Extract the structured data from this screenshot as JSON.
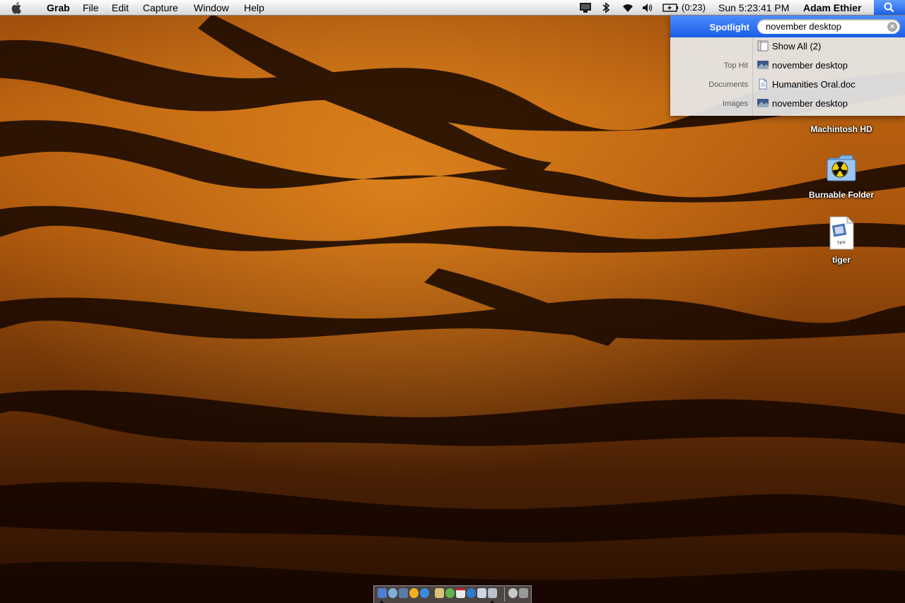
{
  "menubar": {
    "app_name": "Grab",
    "menus": [
      "File",
      "Edit",
      "Capture",
      "Window",
      "Help"
    ],
    "status_icons": [
      "display-icon",
      "bluetooth-icon",
      "wifi-icon",
      "volume-icon",
      "battery-icon"
    ],
    "battery_time": "(0:23)",
    "clock": "Sun 5:23:41 PM",
    "user": "Adam Ethier",
    "spotlight_icon": "search-icon"
  },
  "spotlight": {
    "label": "Spotlight",
    "query": "november desktop",
    "rows": [
      {
        "category": "",
        "icon": "show-all-icon",
        "text": "Show All (2)"
      },
      {
        "category": "Top Hit",
        "icon": "image-file-icon",
        "text": "november desktop"
      },
      {
        "category": "Documents",
        "icon": "document-icon",
        "text": "Humanities Oral.doc"
      },
      {
        "category": "Images",
        "icon": "image-file-icon",
        "text": "november desktop"
      }
    ]
  },
  "desktop_icons": [
    {
      "label": "Machintosh HD",
      "icon": "hard-drive-icon"
    },
    {
      "label": "Burnable Folder",
      "icon": "burnable-folder-icon"
    },
    {
      "label": "tiger",
      "icon": "tiff-file-icon",
      "badge": "TIFF"
    }
  ],
  "colors": {
    "menubar": "#e6e6e6",
    "spotlight_blue": "#1a5de6",
    "wallpaper_orange": "#b8600f",
    "wallpaper_dark": "#1a0a02"
  }
}
